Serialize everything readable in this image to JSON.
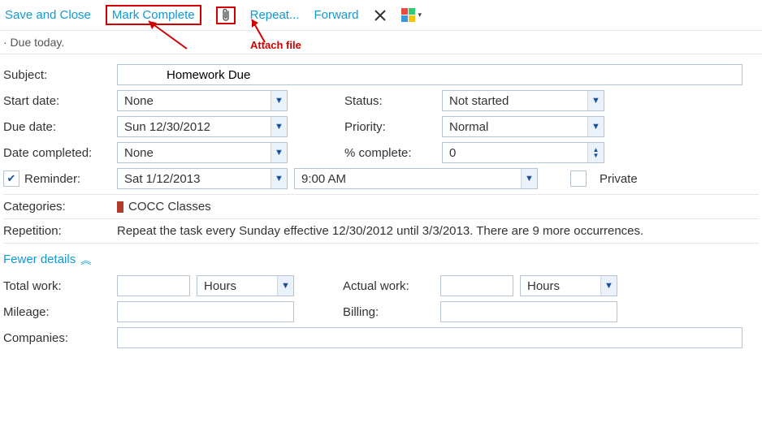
{
  "toolbar": {
    "save_close": "Save and Close",
    "mark_complete": "Mark Complete",
    "repeat": "Repeat...",
    "forward": "Forward"
  },
  "annotations": {
    "attach_file": "Attach file"
  },
  "due_banner": "· Due today.",
  "labels": {
    "subject": "Subject:",
    "start_date": "Start date:",
    "due_date": "Due date:",
    "date_completed": "Date completed:",
    "status": "Status:",
    "priority": "Priority:",
    "pct_complete": "% complete:",
    "reminder": "Reminder:",
    "private": "Private",
    "categories": "Categories:",
    "repetition": "Repetition:",
    "fewer_details": "Fewer details",
    "total_work": "Total work:",
    "actual_work": "Actual work:",
    "mileage": "Mileage:",
    "billing": "Billing:",
    "companies": "Companies:"
  },
  "values": {
    "subject": "Homework Due",
    "start_date": "None",
    "due_date": "Sun 12/30/2012",
    "date_completed": "None",
    "status": "Not started",
    "priority": "Normal",
    "pct_complete": "0",
    "reminder_date": "Sat 1/12/2013",
    "reminder_time": "9:00 AM",
    "category_name": "COCC Classes",
    "repetition_text": "Repeat the task every Sunday effective 12/30/2012 until 3/3/2013. There are 9 more occurrences.",
    "total_work_unit": "Hours",
    "actual_work_unit": "Hours",
    "total_work": "",
    "actual_work": "",
    "mileage": "",
    "billing": "",
    "companies": ""
  }
}
